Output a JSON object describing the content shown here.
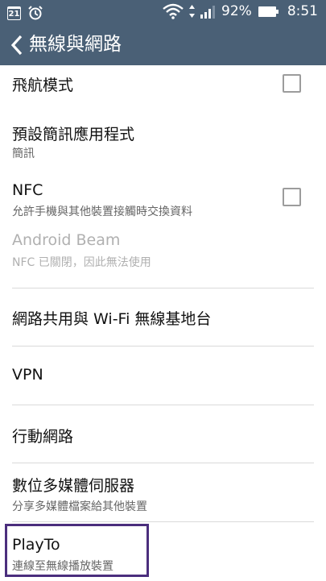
{
  "status_bar": {
    "calendar_day": "21",
    "icons": [
      "calendar-icon",
      "alarm-icon",
      "wifi-icon",
      "data-arrows-icon",
      "signal-icon",
      "battery-icon"
    ],
    "battery": "92%",
    "time": "8:51"
  },
  "app_bar": {
    "title": "無線與網路",
    "color": "#4a6076"
  },
  "items": [
    {
      "title": "飛航模式",
      "checkbox": false
    },
    {
      "title": "預設簡訊應用程式",
      "subtitle": "簡訊"
    },
    {
      "title": "NFC",
      "subtitle": "允許手機與其他裝置接觸時交換資料",
      "checkbox": false
    },
    {
      "title": "Android Beam",
      "subtitle": "NFC 已關閉，因此無法使用",
      "disabled": true
    },
    {
      "title": "網路共用與 Wi-Fi 無線基地台"
    },
    {
      "title": "VPN"
    },
    {
      "title": "行動網路"
    },
    {
      "title": "數位多媒體伺服器",
      "subtitle": "分享多媒體檔案給其他裝置"
    },
    {
      "title": "PlayTo",
      "subtitle": "連線至無線播放裝置"
    }
  ],
  "highlight_color": "#4b2e7d"
}
